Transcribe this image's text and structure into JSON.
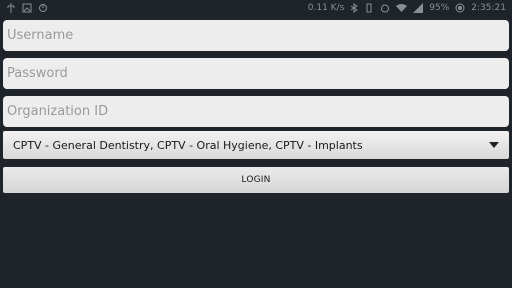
{
  "status_bar": {
    "left_icons": [
      "usb-icon",
      "image-icon",
      "sync-icon"
    ],
    "network_speed": "0.11 K/s",
    "right_icons": [
      "bluetooth-icon",
      "vibrate-icon",
      "alarm-icon",
      "wifi-icon",
      "cell-signal-icon"
    ],
    "battery": "95%",
    "time": "2:35:21"
  },
  "form": {
    "username_placeholder": "Username",
    "password_placeholder": "Password",
    "organization_placeholder": "Organization ID",
    "selected_option": "CPTV - General Dentistry, CPTV - Oral Hygiene, CPTV - Implants",
    "login_label": "LOGIN"
  },
  "colors": {
    "background": "#1f232a",
    "field": "#ededed",
    "placeholder": "#9a9a9a"
  }
}
